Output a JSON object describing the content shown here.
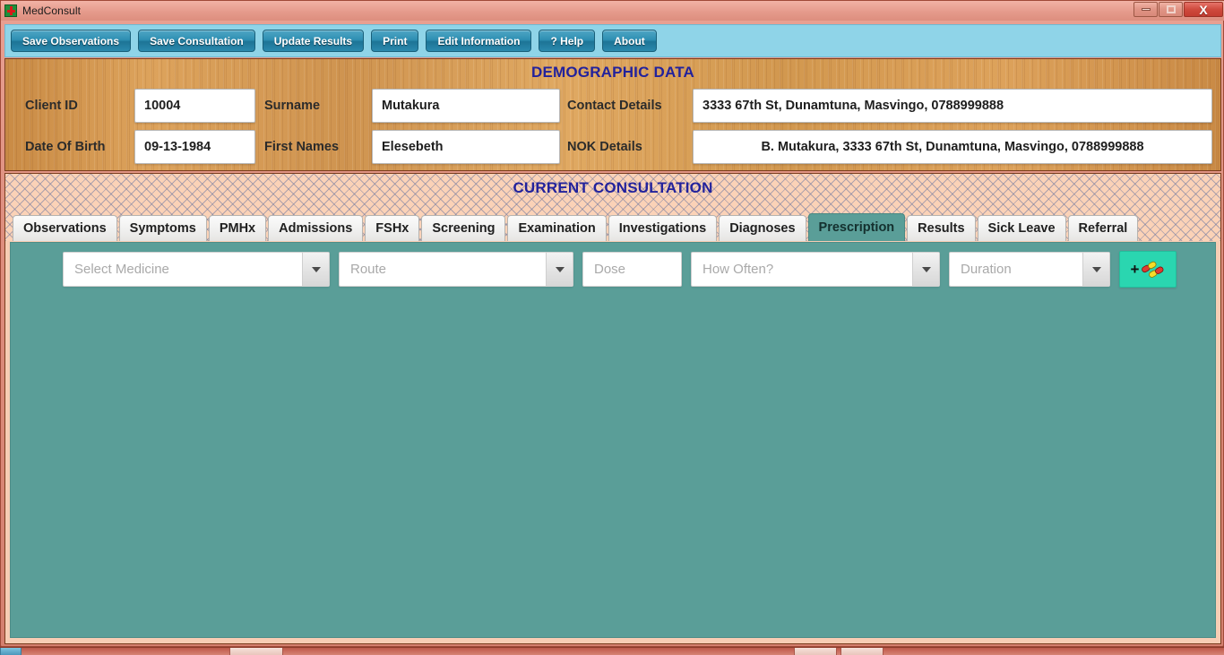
{
  "window": {
    "title": "MedConsult",
    "app_icon": "medical-cross-icon",
    "controls": {
      "minimize": "minimize-icon",
      "maximize": "maximize-icon",
      "close": "X"
    }
  },
  "toolbar": {
    "buttons": [
      {
        "label": "Save Observations",
        "name": "save-observations-button"
      },
      {
        "label": "Save Consultation",
        "name": "save-consultation-button"
      },
      {
        "label": "Update Results",
        "name": "update-results-button"
      },
      {
        "label": "Print",
        "name": "print-button"
      },
      {
        "label": "Edit Information",
        "name": "edit-information-button"
      },
      {
        "label": "? Help",
        "name": "help-button"
      },
      {
        "label": "About",
        "name": "about-button"
      }
    ]
  },
  "demographics": {
    "title": "DEMOGRAPHIC DATA",
    "fields": {
      "client_id_label": "Client ID",
      "client_id_value": "10004",
      "surname_label": "Surname",
      "surname_value": "Mutakura",
      "contact_label": "Contact Details",
      "contact_value": "3333 67th St, Dunamtuna, Masvingo, 0788999888",
      "dob_label": "Date Of Birth",
      "dob_value": "09-13-1984",
      "first_names_label": "First Names",
      "first_names_value": "Elesebeth",
      "nok_label": "NOK Details",
      "nok_value": "B. Mutakura, 3333 67th St, Dunamtuna, Masvingo, 0788999888"
    }
  },
  "consultation": {
    "title": "CURRENT CONSULTATION",
    "tabs": [
      {
        "label": "Observations",
        "name": "tab-observations",
        "active": false
      },
      {
        "label": "Symptoms",
        "name": "tab-symptoms",
        "active": false
      },
      {
        "label": "PMHx",
        "name": "tab-pmhx",
        "active": false
      },
      {
        "label": "Admissions",
        "name": "tab-admissions",
        "active": false
      },
      {
        "label": "FSHx",
        "name": "tab-fshx",
        "active": false
      },
      {
        "label": "Screening",
        "name": "tab-screening",
        "active": false
      },
      {
        "label": "Examination",
        "name": "tab-examination",
        "active": false
      },
      {
        "label": "Investigations",
        "name": "tab-investigations",
        "active": false
      },
      {
        "label": "Diagnoses",
        "name": "tab-diagnoses",
        "active": false
      },
      {
        "label": "Prescription",
        "name": "tab-prescription",
        "active": true
      },
      {
        "label": "Results",
        "name": "tab-results",
        "active": false
      },
      {
        "label": "Sick Leave",
        "name": "tab-sick-leave",
        "active": false
      },
      {
        "label": "Referral",
        "name": "tab-referral",
        "active": false
      }
    ],
    "active_tab": "Prescription"
  },
  "prescription": {
    "medicine_placeholder": "Select Medicine",
    "medicine_value": "",
    "route_placeholder": "Route",
    "route_value": "",
    "dose_placeholder": "Dose",
    "dose_value": "",
    "frequency_placeholder": "How Often?",
    "frequency_value": "",
    "duration_placeholder": "Duration",
    "duration_value": "",
    "add_button_label": "+",
    "add_button_icon": "pill-capsule-icon"
  },
  "colors": {
    "window_chrome": "#dd8d7d",
    "toolbar_bg": "#8fd4e8",
    "toolbar_button": "#2e8fb3",
    "wood_panel": "#d2984f",
    "heading_text": "#22229c",
    "hatch_band": "#fbd2b7",
    "tab_panel_teal": "#5a9e98",
    "add_button_teal": "#2ad6b0"
  }
}
